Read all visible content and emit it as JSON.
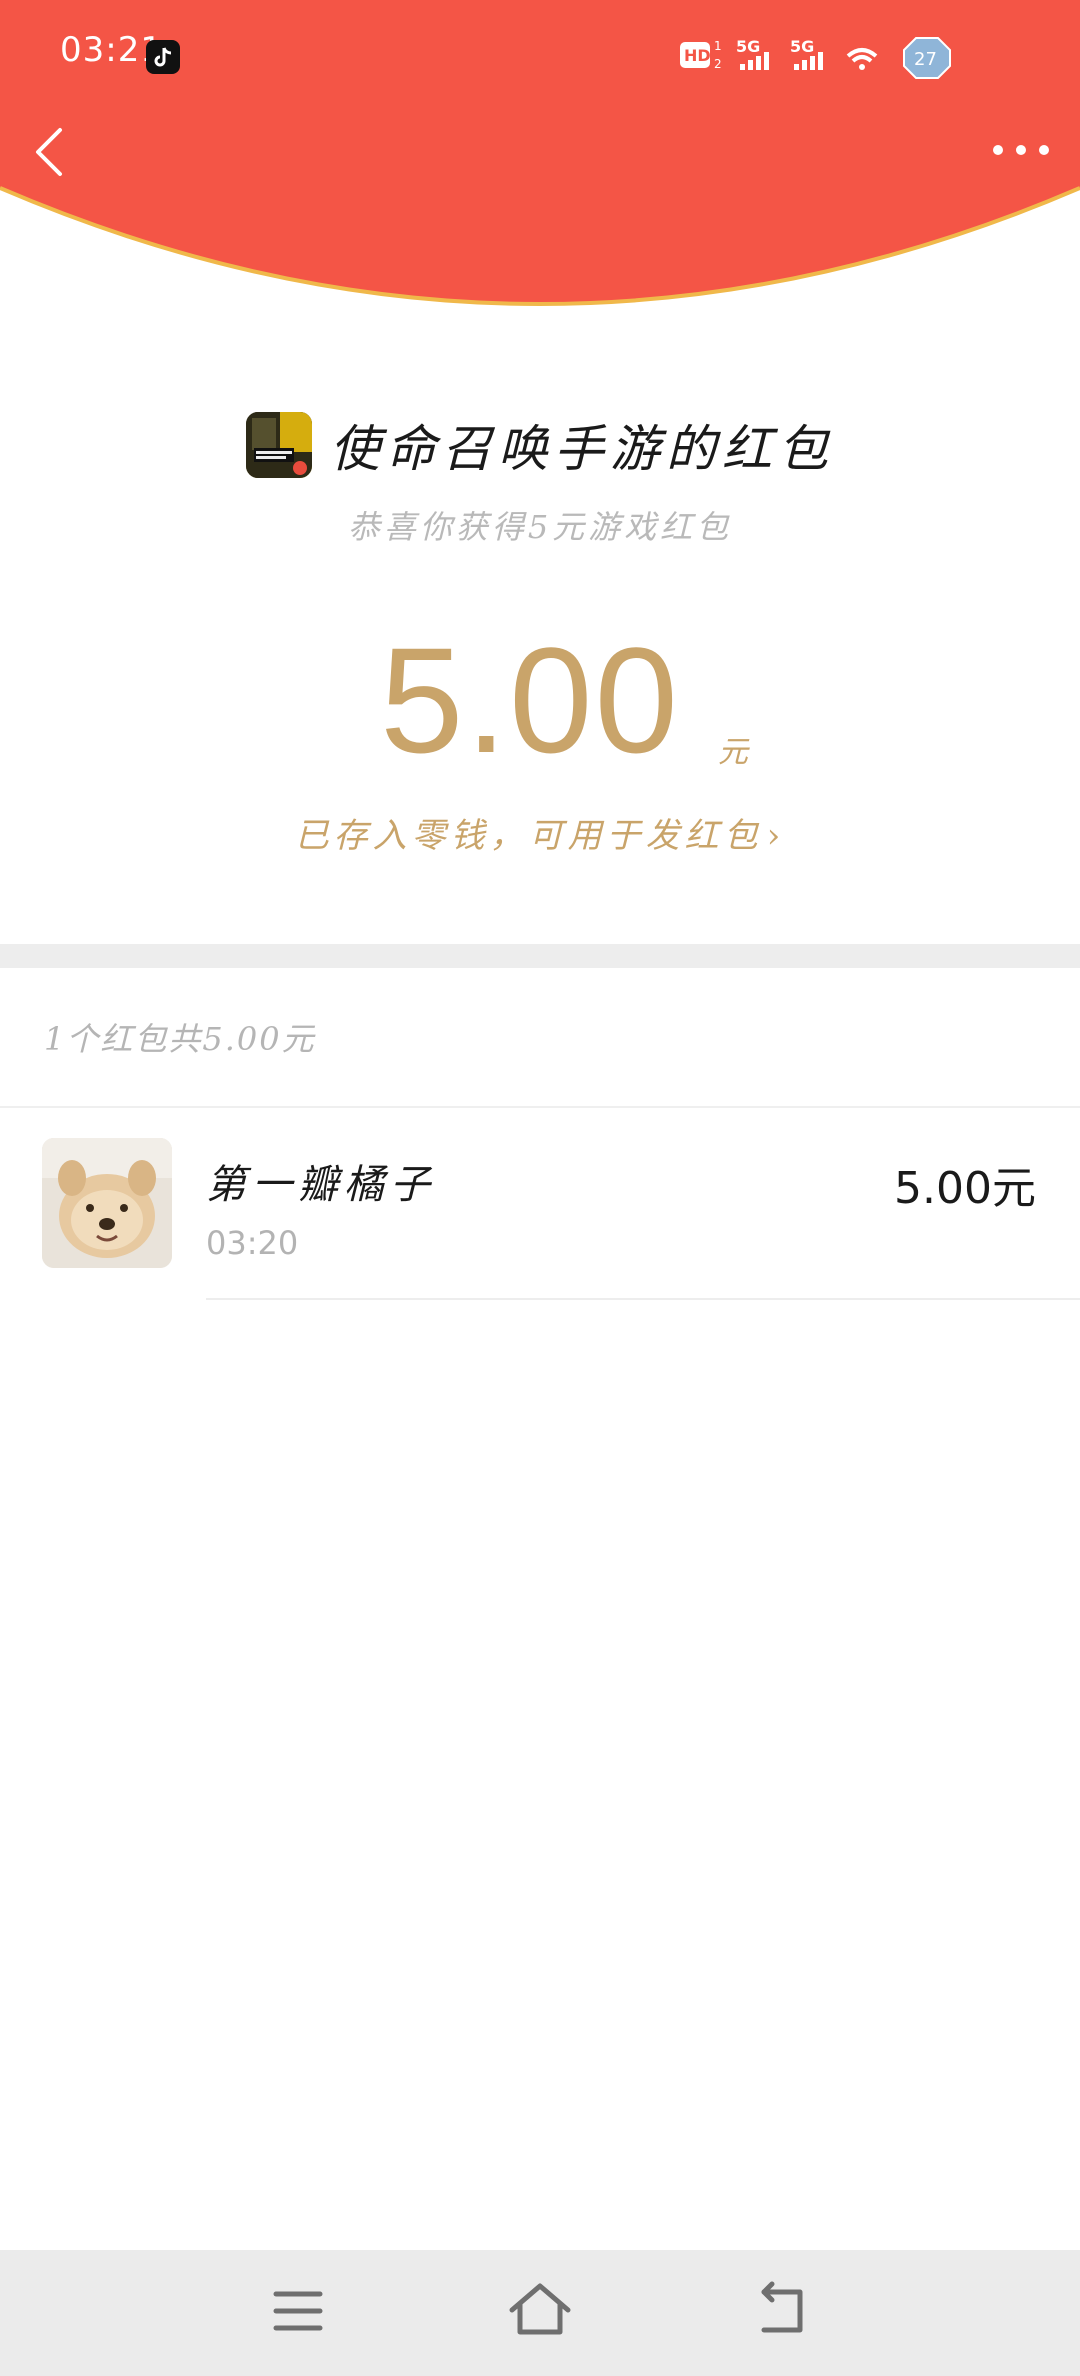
{
  "status_bar": {
    "time": "03:21",
    "battery": "27",
    "network_1": "5G",
    "network_2": "5G",
    "hd_label": "HD"
  },
  "header": {
    "color": "#F45546",
    "edge_color": "#F0B84A"
  },
  "red_packet": {
    "title": "使命召唤手游的红包",
    "subtitle": "恭喜你获得5元游戏红包",
    "amount": "5.00",
    "unit": "元",
    "stored_text": "已存入零钱，可用于发红包",
    "stored_chevron": "›"
  },
  "summary": {
    "text": "1个红包共5.00元"
  },
  "records": [
    {
      "name": "第一瓣橘子",
      "time": "03:20",
      "amount": "5.00元"
    }
  ],
  "colors": {
    "gold": "#C9A46A",
    "text_dark": "#1A1A1A",
    "text_gray": "#B5B5B5",
    "band": "#EDEDED"
  }
}
